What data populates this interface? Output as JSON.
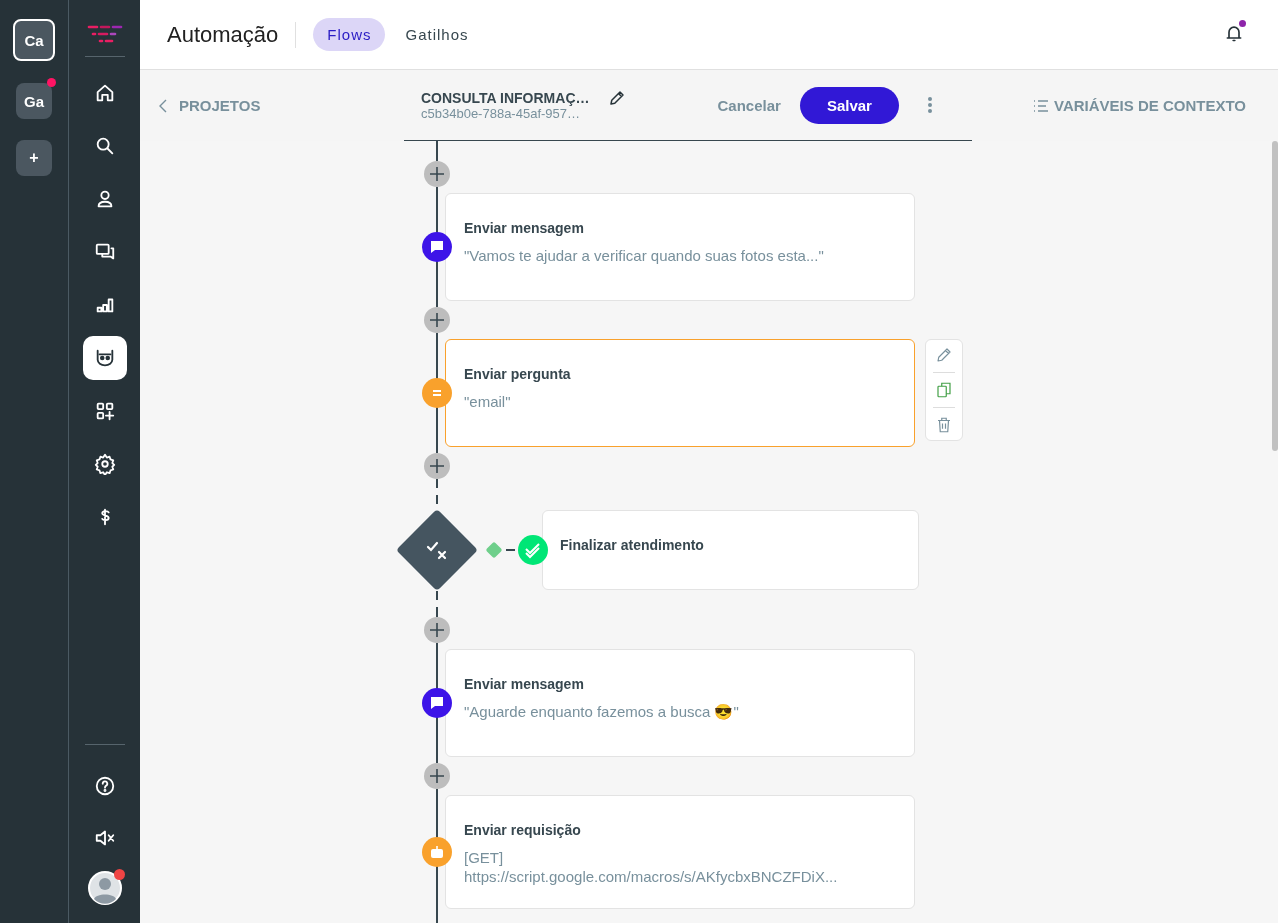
{
  "workspaces": [
    {
      "label": "Ca",
      "selected": true,
      "notification": false
    },
    {
      "label": "Ga",
      "selected": false,
      "notification": true
    }
  ],
  "add_workspace": "+",
  "nav": {
    "items": [
      {
        "selected": false
      },
      {
        "selected": false
      },
      {
        "selected": false
      },
      {
        "selected": false
      },
      {
        "selected": false
      },
      {
        "selected": true
      },
      {
        "selected": false
      },
      {
        "selected": false
      },
      {
        "selected": false
      }
    ],
    "avatar_notification": true
  },
  "header": {
    "title": "Automação",
    "tabs": [
      {
        "label": "Flows",
        "selected": true
      },
      {
        "label": "Gatilhos",
        "selected": false
      }
    ],
    "bell_notification": true
  },
  "toolbar": {
    "back": "PROJETOS",
    "flow_name": "CONSULTA INFORMAÇ…",
    "flow_id": "c5b34b0e-788a-45af-957…",
    "cancel": "Cancelar",
    "save": "Salvar",
    "context_variables": "VARIÁVEIS DE CONTEXTO"
  },
  "steps": [
    {
      "kind": "message",
      "title": "Enviar mensagem",
      "lines": [
        "\"Vamos te ajudar a verificar quando suas fotos esta...\""
      ],
      "selected": false
    },
    {
      "kind": "question",
      "title": "Enviar pergunta",
      "lines": [
        "\"email\""
      ],
      "selected": true
    },
    {
      "kind": "condition",
      "title": "Finalizar atendimento",
      "selected": false
    },
    {
      "kind": "message",
      "title": "Enviar mensagem",
      "lines": [
        "\"Aguarde enquanto fazemos a busca 😎\""
      ],
      "selected": false
    },
    {
      "kind": "request",
      "title": "Enviar requisição",
      "lines": [
        "[GET]",
        "https://script.google.com/macros/s/AKfycbxBNCZFDiX..."
      ],
      "selected": false
    }
  ]
}
